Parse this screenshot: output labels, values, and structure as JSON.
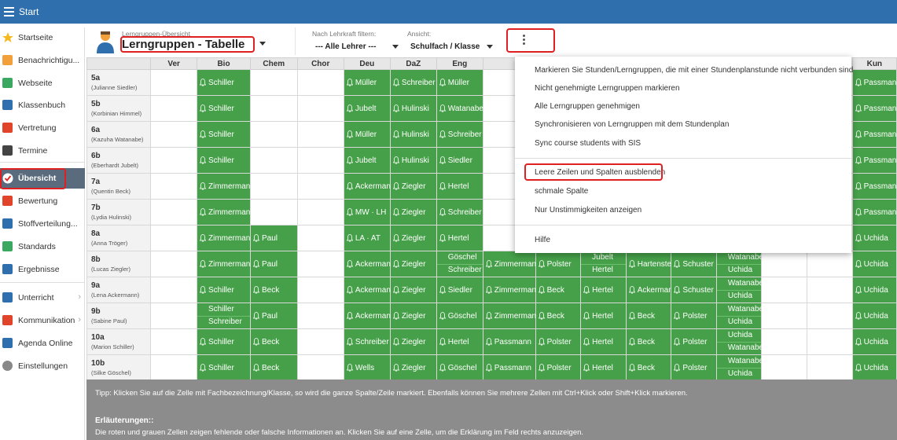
{
  "topbar": {
    "title": "Start"
  },
  "sidebar": {
    "items": [
      {
        "label": "Startseite",
        "icon": "star-icon",
        "color": "#f5b81e"
      },
      {
        "label": "Benachrichtigu...",
        "icon": "envelope-icon",
        "color": "#f2a03a"
      },
      {
        "label": "Webseite",
        "icon": "home-icon",
        "color": "#3aa860"
      },
      {
        "label": "Klassenbuch",
        "icon": "book-icon",
        "color": "#2f6fae"
      },
      {
        "label": "Vertretung",
        "icon": "swap-icon",
        "color": "#e0442a"
      },
      {
        "label": "Termine",
        "icon": "calendar-icon",
        "color": "#444444"
      },
      {
        "label": "Übersicht",
        "icon": "check-icon",
        "color": "#ffffff"
      },
      {
        "label": "Bewertung",
        "icon": "grade-icon",
        "color": "#e0442a"
      },
      {
        "label": "Stoffverteilung...",
        "icon": "list-icon",
        "color": "#2f6fae"
      },
      {
        "label": "Standards",
        "icon": "shield-icon",
        "color": "#3aa860"
      },
      {
        "label": "Ergebnisse",
        "icon": "chart-icon",
        "color": "#2f6fae"
      },
      {
        "label": "Unterricht",
        "icon": "class-icon",
        "color": "#2f6fae"
      },
      {
        "label": "Kommunikation",
        "icon": "chat-icon",
        "color": "#e0442a"
      },
      {
        "label": "Agenda Online",
        "icon": "pen-icon",
        "color": "#2f6fae"
      },
      {
        "label": "Einstellungen",
        "icon": "gear-icon",
        "color": "#888888"
      }
    ]
  },
  "header": {
    "subtitle": "Lerngruppen-Übersicht",
    "title": "Lerngruppen - Tabelle",
    "filter_label": "Nach Lehrkraft filtern:",
    "filter_value": "--- Alle Lehrer ---",
    "view_label": "Ansicht:",
    "view_value": "Schulfach / Klasse"
  },
  "table": {
    "columns": [
      "Ver",
      "Bio",
      "Chem",
      "Chor",
      "Deu",
      "DaZ",
      "Eng",
      "",
      "",
      "",
      "",
      "",
      "",
      "",
      "",
      "Kun"
    ],
    "rows": [
      {
        "class": "5a",
        "teacher": "(Julianne Siedler)",
        "cells": [
          "",
          "Schiller",
          "",
          "",
          "Müller",
          "Schreiber",
          "Müller",
          "",
          "",
          "",
          "",
          "",
          "",
          "",
          "",
          "Passmann"
        ]
      },
      {
        "class": "5b",
        "teacher": "(Korbinian Himmel)",
        "cells": [
          "",
          "Schiller",
          "",
          "",
          "Jubelt",
          "Hulinski",
          "Watanabe",
          "",
          "",
          "",
          "",
          "",
          "",
          "",
          "",
          "Passmann"
        ]
      },
      {
        "class": "6a",
        "teacher": "(Kazuha Watanabe)",
        "cells": [
          "",
          "Schiller",
          "",
          "",
          "Müller",
          "Hulinski",
          "Schreiber",
          "",
          "",
          "",
          "",
          "",
          "",
          "",
          "",
          "Passmann"
        ]
      },
      {
        "class": "6b",
        "teacher": "(Eberhardt Jubelt)",
        "cells": [
          "",
          "Schiller",
          "",
          "",
          "Jubelt",
          "Hulinski",
          "Siedler",
          "",
          "",
          "",
          "",
          "",
          "",
          "",
          "",
          "Passmann"
        ]
      },
      {
        "class": "7a",
        "teacher": "(Quentin Beck)",
        "cells": [
          "",
          "Zimmermann",
          "",
          "",
          "Ackermann",
          "Ziegler",
          "Hertel",
          "",
          "",
          "",
          "",
          "",
          "",
          "",
          "",
          "Passmann"
        ]
      },
      {
        "class": "7b",
        "teacher": "(Lydia Hulinski)",
        "cells": [
          "",
          "Zimmermann",
          "",
          "",
          "MW · LH",
          "Ziegler",
          "Schreiber",
          "",
          "",
          "",
          "",
          "",
          "",
          "",
          "",
          "Passmann"
        ]
      },
      {
        "class": "8a",
        "teacher": "(Anna Tröger)",
        "cells": [
          "",
          "Zimmermann",
          "Paul",
          "",
          "LA · AT",
          "Ziegler",
          "Hertel",
          "",
          "",
          "",
          "",
          "",
          "",
          "",
          "",
          "Uchida"
        ]
      },
      {
        "class": "8b",
        "teacher": "(Lucas Ziegler)",
        "cells": [
          "",
          "Zimmermann",
          "Paul",
          "",
          "Ackermann",
          "Ziegler",
          "Göschel|Schreiber",
          "Zimmermann",
          "Polster",
          "Jubelt|Hertel",
          "Hartenstein",
          "Schuster",
          "Watanabe|Uchida",
          "",
          "",
          "Uchida"
        ]
      },
      {
        "class": "9a",
        "teacher": "(Lena Ackermann)",
        "cells": [
          "",
          "Schiller",
          "Beck",
          "",
          "Ackermann",
          "Ziegler",
          "Siedler",
          "Zimmermann",
          "Beck",
          "Hertel",
          "Ackermann",
          "Schuster",
          "Watanabe|Uchida",
          "",
          "",
          "Uchida"
        ]
      },
      {
        "class": "9b",
        "teacher": "(Sabine Paul)",
        "cells": [
          "",
          "Schiller|Schreiber",
          "Paul",
          "",
          "Ackermann",
          "Ziegler",
          "Göschel",
          "Zimmermann",
          "Beck",
          "Hertel",
          "Beck",
          "Polster",
          "Watanabe|Uchida",
          "",
          "",
          "Uchida"
        ]
      },
      {
        "class": "10a",
        "teacher": "(Marion Schiller)",
        "cells": [
          "",
          "Schiller",
          "Beck",
          "",
          "Schreiber",
          "Ziegler",
          "Hertel",
          "Passmann",
          "Polster",
          "Hertel",
          "Beck",
          "Polster",
          "Uchida|Watanabe",
          "",
          "",
          "Uchida"
        ]
      },
      {
        "class": "10b",
        "teacher": "(Silke Göschel)",
        "cells": [
          "",
          "Schiller",
          "Beck",
          "",
          "Wells",
          "Ziegler",
          "Göschel",
          "Passmann",
          "Polster",
          "Hertel",
          "Beck",
          "Polster",
          "Watanabe|Uchida",
          "",
          "",
          "Uchida"
        ]
      }
    ]
  },
  "dropdown": {
    "items": [
      "Markieren Sie Stunden/Lerngruppen, die mit einer Stundenplanstunde nicht verbunden sind",
      "Nicht genehmigte Lerngruppen markieren",
      "Alle Lerngruppen genehmigen",
      "Synchronisieren von Lerngruppen mit dem Stundenplan",
      "Sync course students with SIS",
      "Leere Zeilen und Spalten ausblenden",
      "schmale Spalte",
      "Nur Unstimmigkeiten anzeigen",
      "Hilfe"
    ]
  },
  "footer": {
    "tip": "Tipp: Klicken Sie auf die Zelle mit Fachbezeichnung/Klasse, so wird die ganze Spalte/Zeile markiert. Ebenfalls können Sie mehrere Zellen mit Ctrl+Klick oder Shift+Klick markieren.",
    "explain_heading": "Erläuterungen::",
    "explain_text": "Die roten und grauen Zellen zeigen fehlende oder falsche Informationen an. Klicken Sie auf eine Zelle, um die Erklärung im Feld rechts anzuzeigen."
  },
  "colors": {
    "topbar": "#2f6fae",
    "cell_green": "#46a049",
    "active_sidebar": "#5a6b7d",
    "highlight": "#e02020",
    "footer": "#8c8c8c"
  }
}
